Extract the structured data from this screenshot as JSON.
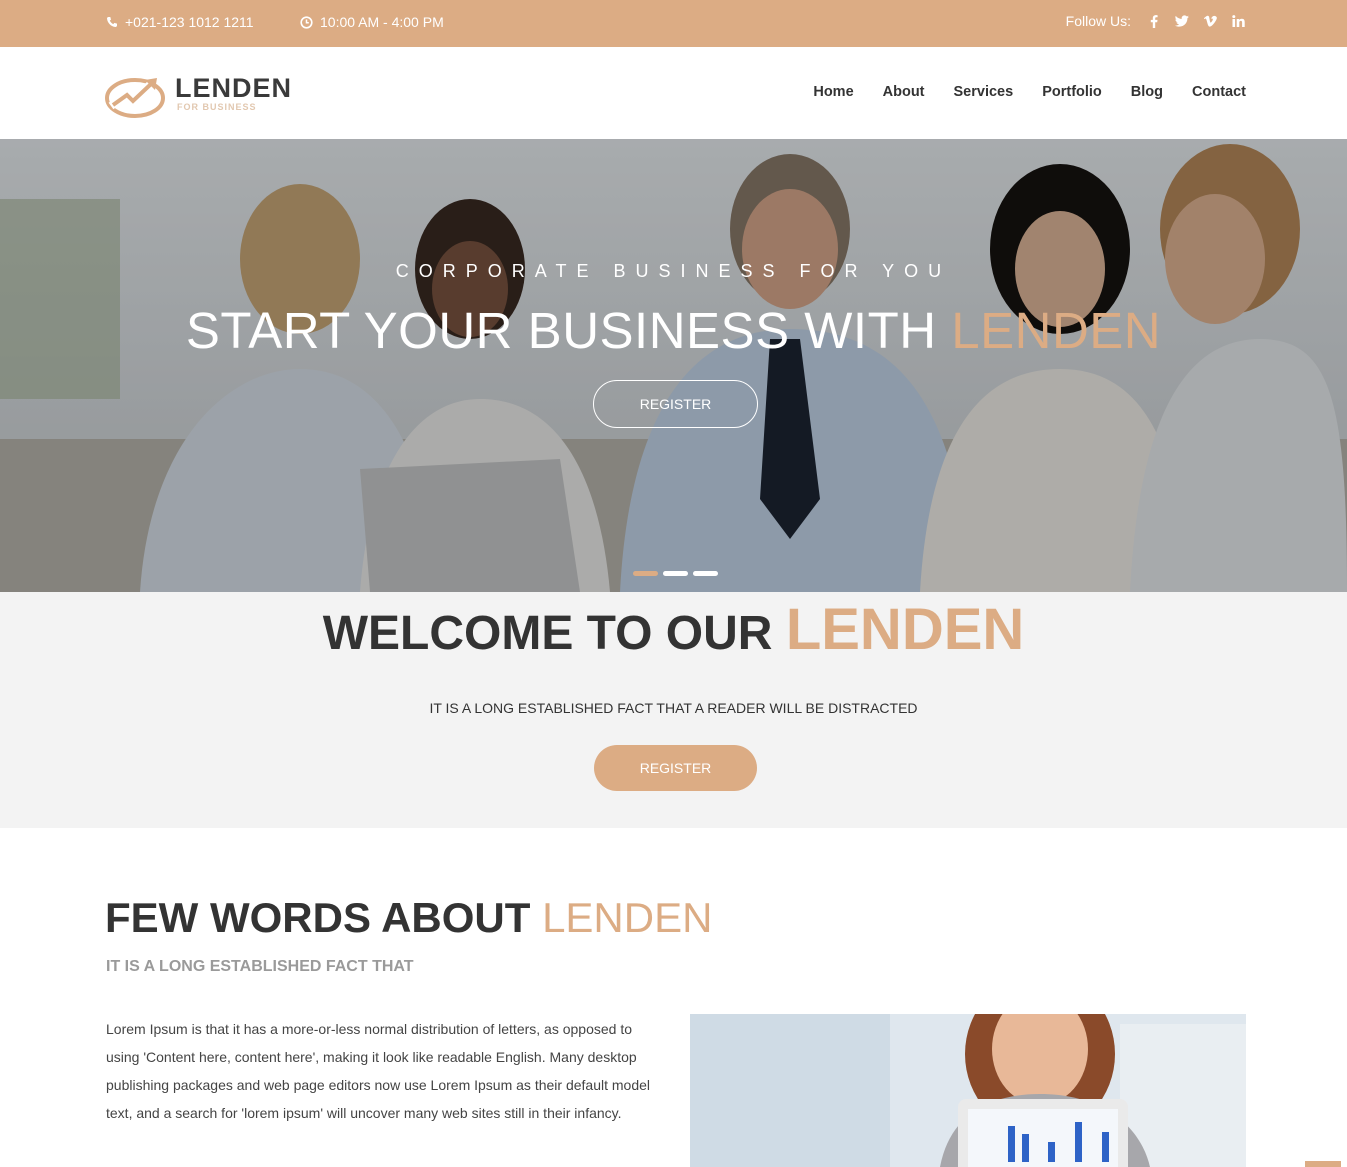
{
  "topbar": {
    "phone": "+021-123 1012 1211",
    "hours": "10:00 AM - 4:00 PM",
    "follow_label": "Follow Us:",
    "social": [
      "facebook-icon",
      "twitter-icon",
      "vimeo-icon",
      "linkedin-icon"
    ]
  },
  "logo": {
    "name": "LENDEN",
    "tagline": "FOR BUSINESS"
  },
  "nav": [
    "Home",
    "About",
    "Services",
    "Portfolio",
    "Blog",
    "Contact"
  ],
  "hero": {
    "kicker": "CORPORATE BUSINESS FOR YOU",
    "title_main": "START YOUR BUSINESS WITH ",
    "title_accent": "LENDEN",
    "button": "REGISTER",
    "slides": 3,
    "active_slide": 1
  },
  "welcome": {
    "title_main": "WELCOME TO OUR ",
    "title_accent": "LENDEN",
    "subtitle": "IT IS A LONG ESTABLISHED FACT THAT A READER WILL BE DISTRACTED",
    "button": "REGISTER"
  },
  "about": {
    "title_main": "FEW WORDS ABOUT ",
    "title_accent": "LENDEN",
    "subtitle": "IT IS A LONG ESTABLISHED FACT THAT",
    "body": "Lorem Ipsum is that it has a more-or-less normal distribution of letters, as opposed to using 'Content here, content here', making it look like readable English. Many desktop publishing packages and web page editors now use Lorem Ipsum as their default model text, and a search for 'lorem ipsum' will uncover many web sites still in their infancy."
  },
  "colors": {
    "accent": "#dcac84",
    "topbar_bg": "#dcac84",
    "section_bg": "#f3f3f3",
    "dark_text": "#333333"
  }
}
